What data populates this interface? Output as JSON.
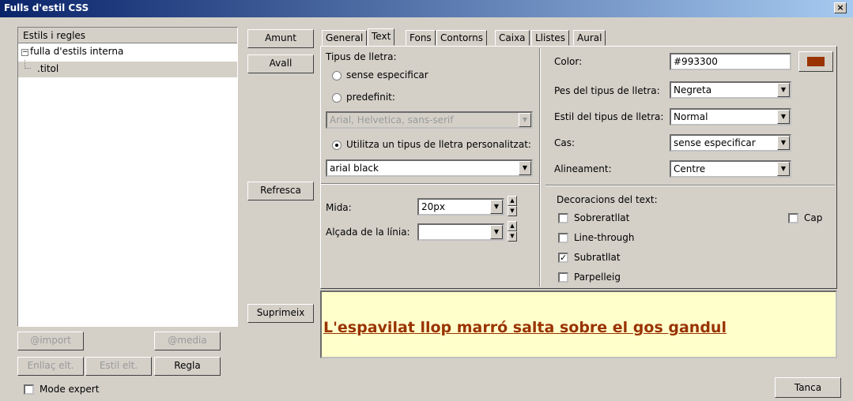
{
  "window": {
    "title": "Fulls d'estil CSS",
    "close_glyph": "×"
  },
  "tree": {
    "header": "Estils i regles",
    "root_label": "fulla d'estils interna",
    "child_label": ".titol",
    "expander": "−"
  },
  "side_buttons": {
    "up": "Amunt",
    "down": "Avall",
    "refresh": "Refresca",
    "delete": "Suprimeix"
  },
  "bottom_buttons": {
    "import": "@import",
    "media": "@media",
    "link": "Enllaç elt.",
    "style": "Estil elt.",
    "rule": "Regla"
  },
  "expert": {
    "label": "Mode expert",
    "checked": false
  },
  "close_button": "Tanca",
  "tabs": [
    {
      "label": "General"
    },
    {
      "label": "Text"
    },
    {
      "label": "Fons"
    },
    {
      "label": "Contorns"
    },
    {
      "label": "Caixa"
    },
    {
      "label": "Llistes"
    },
    {
      "label": "Aural"
    }
  ],
  "active_tab": "Text",
  "font": {
    "section": "Tipus de lletra:",
    "opt_unspecified": "sense especificar",
    "opt_predefined": "predefinit:",
    "predefined_value": "Arial, Helvetica, sans-serif",
    "opt_custom": "Utilitza un tipus de lletra personalitzat:",
    "custom_value": "arial black",
    "selected": "custom"
  },
  "size": {
    "label": "Mida:",
    "value": "20px"
  },
  "line_height": {
    "label": "Alçada de la línia:",
    "value": ""
  },
  "color": {
    "label": "Color:",
    "value": "#993300",
    "swatch": "#993300"
  },
  "weight": {
    "label": "Pes del tipus de lletra:",
    "value": "Negreta"
  },
  "style": {
    "label": "Estil del tipus de lletra:",
    "value": "Normal"
  },
  "case": {
    "label": "Cas:",
    "value": "sense especificar"
  },
  "align": {
    "label": "Alineament:",
    "value": "Centre"
  },
  "decorations": {
    "title": "Decoracions del text:",
    "overline": {
      "label": "Sobreratllat",
      "checked": false
    },
    "line_through": {
      "label": "Line-through",
      "checked": false
    },
    "underline": {
      "label": "Subratllat",
      "checked": true
    },
    "blink": {
      "label": "Parpelleig",
      "checked": false
    },
    "none": {
      "label": "Cap",
      "checked": false
    }
  },
  "preview_text": "L'espavilat llop marró salta sobre el gos gandul",
  "preview_color": "#993300"
}
